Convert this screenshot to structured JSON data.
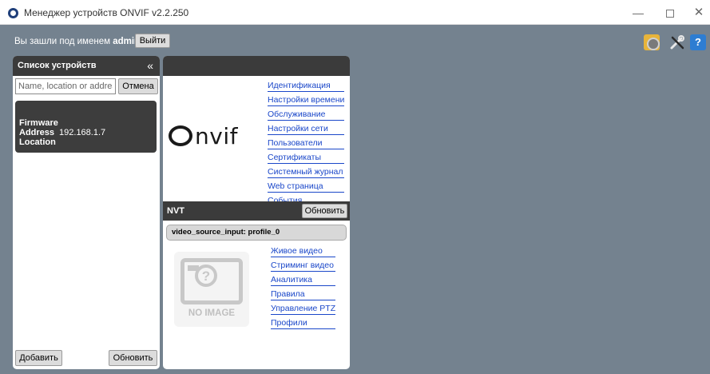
{
  "window": {
    "title": "Менеджер устройств ONVIF v2.2.250",
    "minimize": "—",
    "close": "✕"
  },
  "session": {
    "logged_in_as": "Вы зашли под именем",
    "username": "admin",
    "logout_label": "Выйти"
  },
  "device_list": {
    "title": "Список устройств",
    "collapse_glyph": "«",
    "search_placeholder": "Name, location or address",
    "cancel_label": "Отмена",
    "devices": [
      {
        "firmware_label": "Firmware",
        "address_label": "Address",
        "address_value": "192.168.1.7",
        "location_label": "Location"
      }
    ],
    "add_label": "Добавить",
    "refresh_label": "Обновить"
  },
  "device_panel": {
    "logo_first": "",
    "logo_rest": "nvif",
    "links": [
      "Идентификация",
      "Настройки времени",
      "Обслуживание",
      "Настройки сети",
      "Пользователи",
      "Сертификаты",
      "Системный журнал",
      "Web страница",
      "События"
    ],
    "nvt_label": "NVT",
    "nvt_refresh_label": "Обновить",
    "profile_label": "video_source_input: profile_0",
    "no_image_text": "NO IMAGE",
    "no_image_glyph": "?",
    "profile_links": [
      "Живое видео",
      "Стриминг видео",
      "Аналитика",
      "Правила",
      "Управление PTZ",
      "Профили"
    ]
  },
  "toolbar_icons": [
    "settings-icon",
    "tools-icon",
    "help-icon"
  ],
  "help_glyph": "?",
  "colors": {
    "background": "#74828f",
    "panel_header": "#3b3b3b",
    "link": "#1a47c9"
  }
}
